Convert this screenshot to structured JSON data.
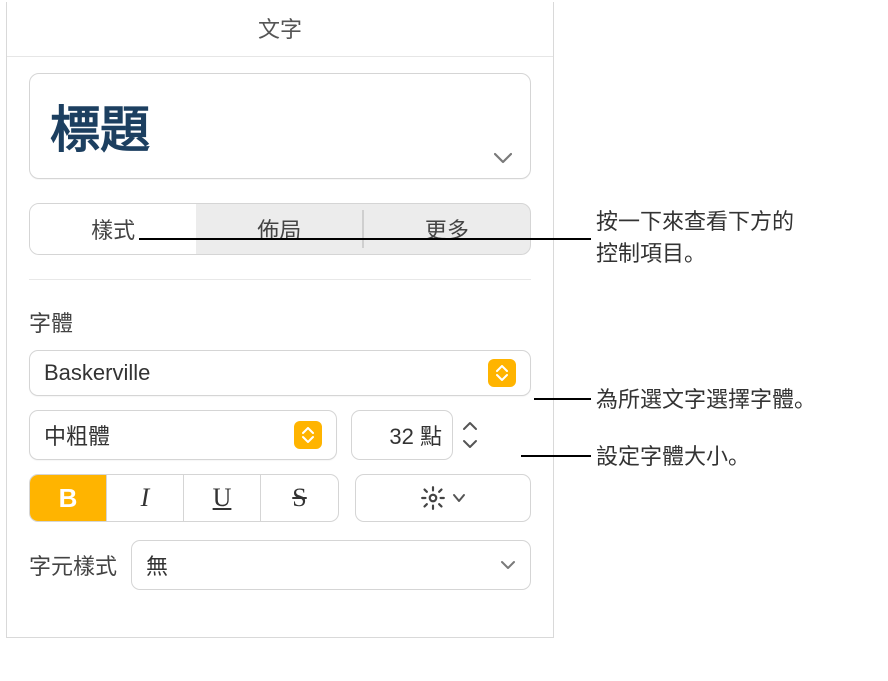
{
  "header": "文字",
  "paragraph_style": "標題",
  "tabs": {
    "style": "樣式",
    "layout": "佈局",
    "more": "更多"
  },
  "font": {
    "section_label": "字體",
    "family": "Baskerville",
    "weight": "中粗體",
    "size_display": "32 點"
  },
  "bius": {
    "b": "B",
    "i": "I",
    "u": "U",
    "s": "S"
  },
  "char_style": {
    "label": "字元樣式",
    "value": "無"
  },
  "callouts": {
    "tabs_line1": "按一下來查看下方的",
    "tabs_line2": "控制項目。",
    "font_family": "為所選文字選擇字體。",
    "font_size": "設定字體大小。"
  }
}
